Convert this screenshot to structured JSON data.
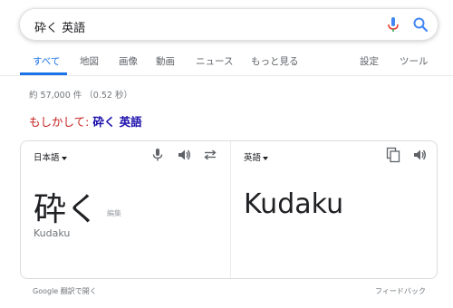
{
  "search": {
    "query": "砕く 英語"
  },
  "tabs": [
    {
      "label": "すべて"
    },
    {
      "label": "地図"
    },
    {
      "label": "画像"
    },
    {
      "label": "動画"
    },
    {
      "label": "ニュース"
    },
    {
      "label": "もっと見る"
    },
    {
      "label": "設定"
    },
    {
      "label": "ツール"
    }
  ],
  "results": {
    "stats": "約 57,000 件 （0.52 秒）"
  },
  "did_you_mean": {
    "prefix": "もしかして:",
    "suggestion": "砕く 英語"
  },
  "translate": {
    "source_lang": "日本語",
    "target_lang": "英語",
    "source_text": "砕く",
    "edit_label": "編集",
    "transliteration": "Kudaku",
    "target_text": "Kudaku"
  },
  "footer": {
    "open_in_translate": "Google 翻訳で開く",
    "feedback": "フィードバック"
  },
  "colors": {
    "accent": "#1a73e8",
    "link": "#1a0dab",
    "did_you_mean": "#c5221f",
    "mic_red": "#ea4335"
  }
}
